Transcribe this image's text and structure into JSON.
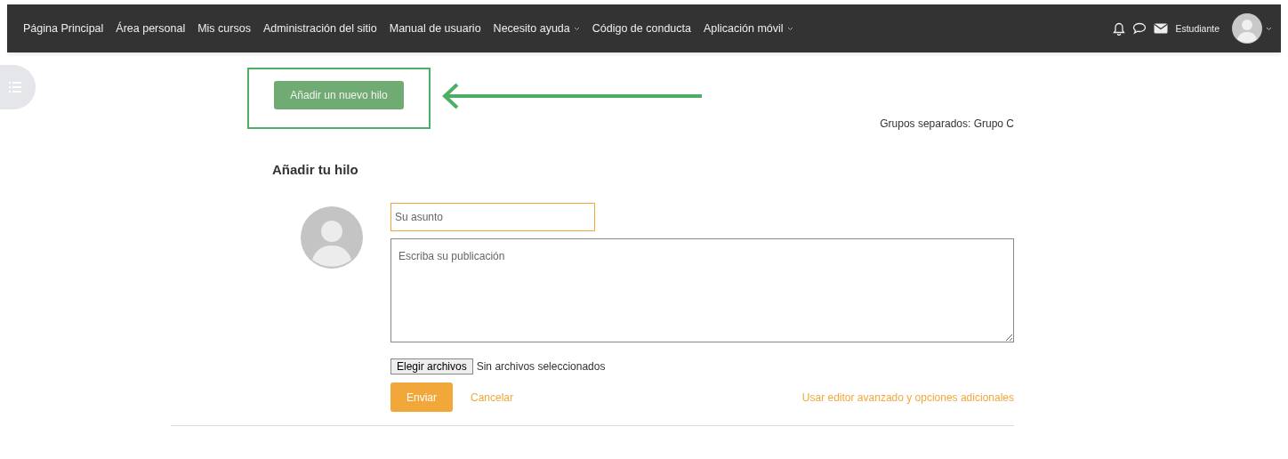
{
  "navbar": {
    "items": [
      {
        "label": "Página Principal",
        "dropdown": false
      },
      {
        "label": "Área personal",
        "dropdown": false
      },
      {
        "label": "Mis cursos",
        "dropdown": false
      },
      {
        "label": "Administración del sitio",
        "dropdown": false
      },
      {
        "label": "Manual de usuario",
        "dropdown": false
      },
      {
        "label": "Necesito ayuda",
        "dropdown": true
      },
      {
        "label": "Código de conducta",
        "dropdown": false
      },
      {
        "label": "Aplicación móvil",
        "dropdown": true
      }
    ],
    "user_name": "Estudiante"
  },
  "add_thread_button": "Añadir un nuevo hilo",
  "group_mode": "Grupos separados: Grupo C",
  "form": {
    "title": "Añadir tu hilo",
    "subject": {
      "placeholder": "Su asunto"
    },
    "message": {
      "placeholder": "Escriba su publicación"
    },
    "file_button": "Elegir archivos",
    "file_status": "Sin archivos seleccionados",
    "submit": "Enviar",
    "cancel": "Cancelar",
    "advanced_link": "Usar editor avanzado y opciones adicionales"
  }
}
